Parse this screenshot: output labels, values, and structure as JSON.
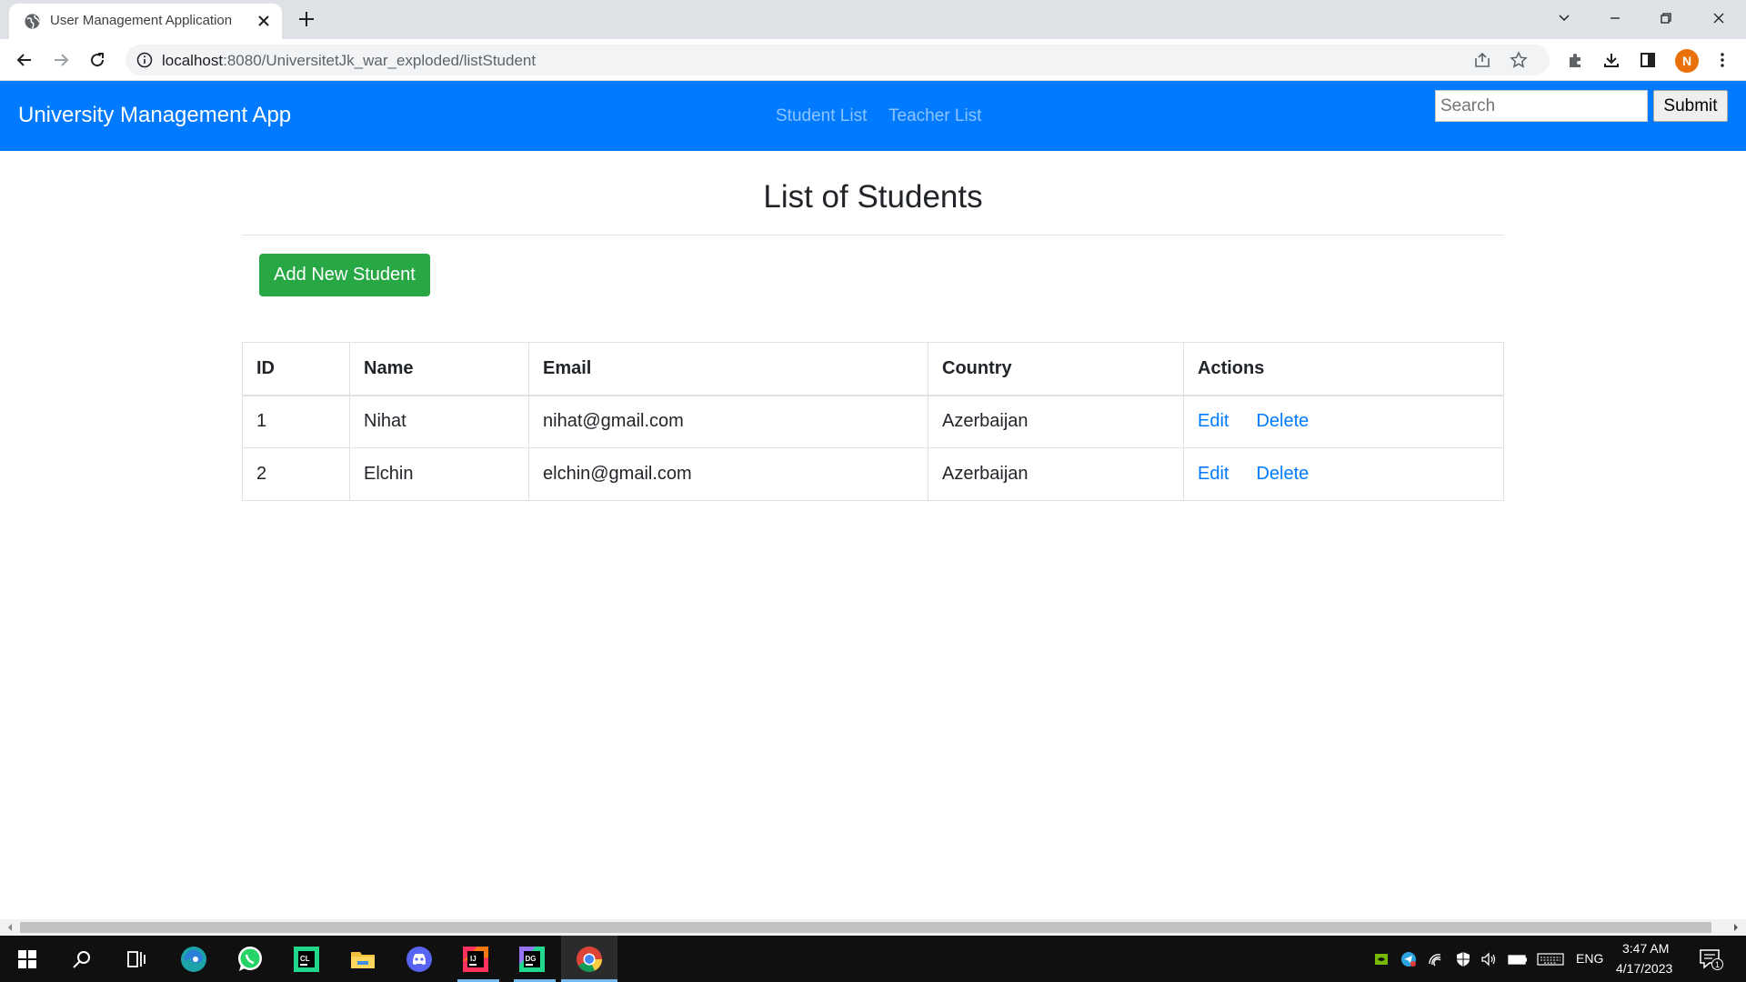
{
  "browser": {
    "tab_title": "User Management Application",
    "url_host": "localhost",
    "url_rest": ":8080/UniversitetJk_war_exploded/listStudent",
    "profile_initial": "N"
  },
  "navbar": {
    "brand": "University Management App",
    "links": [
      "Student List",
      "Teacher List"
    ],
    "search_placeholder": "Search",
    "submit_label": "Submit"
  },
  "main": {
    "title": "List of Students",
    "add_button": "Add New Student",
    "table": {
      "headers": [
        "ID",
        "Name",
        "Email",
        "Country",
        "Actions"
      ],
      "rows": [
        {
          "id": "1",
          "name": "Nihat",
          "email": "nihat@gmail.com",
          "country": "Azerbaijan",
          "edit": "Edit",
          "delete": "Delete"
        },
        {
          "id": "2",
          "name": "Elchin",
          "email": "elchin@gmail.com",
          "country": "Azerbaijan",
          "edit": "Edit",
          "delete": "Delete"
        }
      ]
    }
  },
  "taskbar": {
    "apps": [
      "windows-start-icon",
      "search-icon",
      "task-view-icon",
      "edge-icon",
      "whatsapp-icon",
      "clion-icon",
      "file-explorer-icon",
      "discord-icon",
      "intellij-icon",
      "datagrip-icon",
      "chrome-icon"
    ],
    "language": "ENG",
    "time": "3:47 AM",
    "date": "4/17/2023",
    "notification_count": "1"
  },
  "colors": {
    "navbar": "#007bff",
    "add_button": "#28a745",
    "link": "#007bff"
  }
}
